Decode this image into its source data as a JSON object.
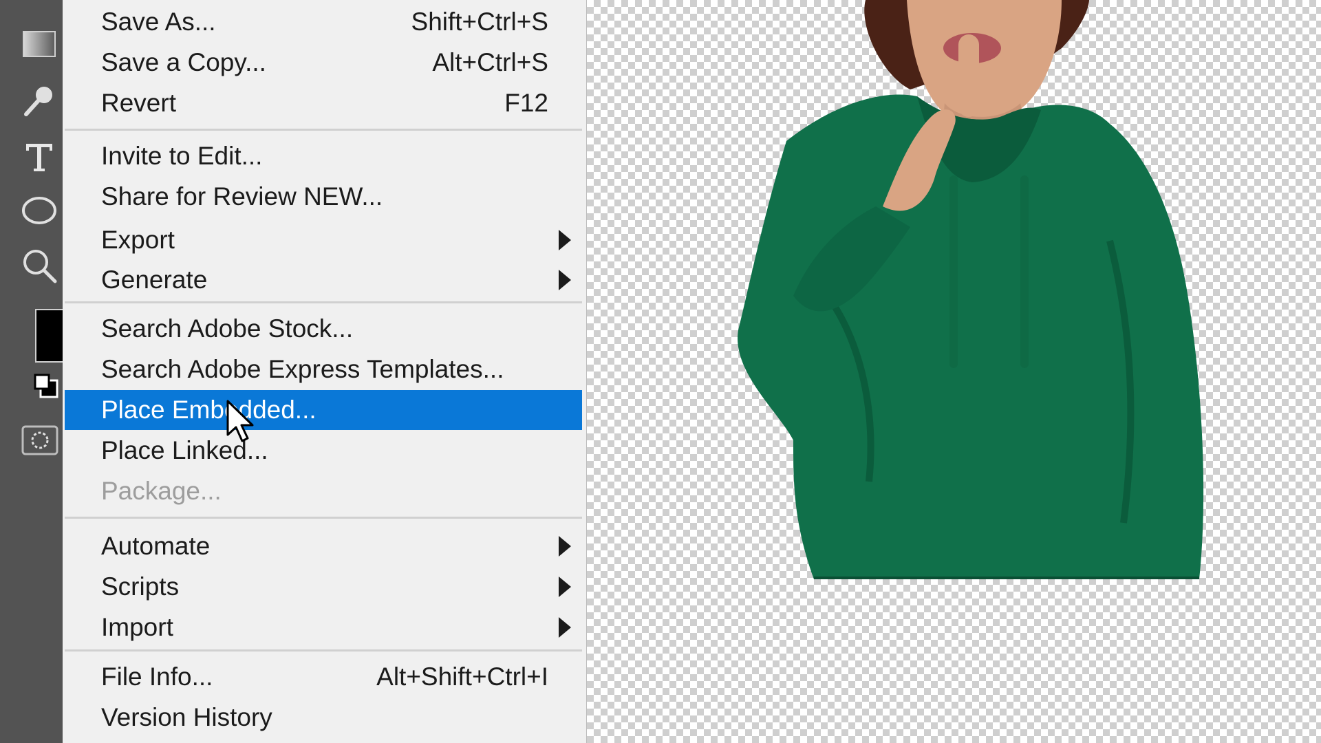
{
  "colors": {
    "menu_bg": "#f0f0f0",
    "highlight": "#0a78d7",
    "toolbar_bg": "#535353",
    "hoodie": "#10704a",
    "disabled_text": "#9d9d9d"
  },
  "toolbar": {
    "tools": [
      {
        "name": "gradient-tool-icon"
      },
      {
        "name": "brush-tool-icon"
      },
      {
        "name": "type-tool-icon"
      },
      {
        "name": "ellipse-tool-icon"
      },
      {
        "name": "zoom-tool-icon"
      },
      {
        "name": "foreground-color-swatch"
      },
      {
        "name": "default-colors-icon"
      },
      {
        "name": "quick-mask-icon"
      }
    ]
  },
  "menu": {
    "items": [
      {
        "label": "Save As...",
        "shortcut": "Shift+Ctrl+S"
      },
      {
        "label": "Save a Copy...",
        "shortcut": "Alt+Ctrl+S"
      },
      {
        "label": "Revert",
        "shortcut": "F12"
      },
      {
        "label": "Invite to Edit..."
      },
      {
        "label": "Share for Review NEW..."
      },
      {
        "label": "Export",
        "submenu": true
      },
      {
        "label": "Generate",
        "submenu": true
      },
      {
        "label": "Search Adobe Stock..."
      },
      {
        "label": "Search Adobe Express Templates..."
      },
      {
        "label": "Place Embedded...",
        "highlighted": true
      },
      {
        "label": "Place Linked..."
      },
      {
        "label": "Package...",
        "disabled": true
      },
      {
        "label": "Automate",
        "submenu": true
      },
      {
        "label": "Scripts",
        "submenu": true
      },
      {
        "label": "Import",
        "submenu": true
      },
      {
        "label": "File Info...",
        "shortcut": "Alt+Shift+Ctrl+I"
      },
      {
        "label": "Version History"
      }
    ]
  },
  "canvas": {
    "background": "transparency-checkerboard",
    "subject": "woman in green hoodie gesturing shush"
  }
}
